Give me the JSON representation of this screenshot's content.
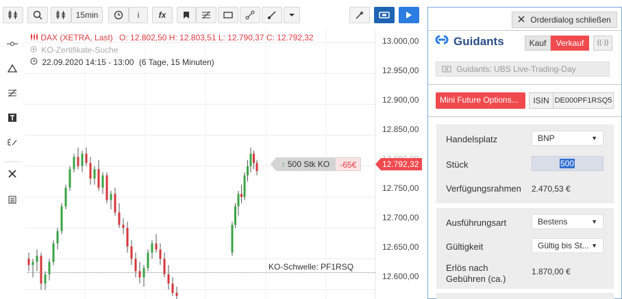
{
  "toolbar": {
    "interval_label": "15min",
    "info_label": "i",
    "fx_label": "fx"
  },
  "legend": {
    "instrument": "DAX (XETRA, Last)",
    "ohlc": "O: 12.802,50  H: 12.803,51  L: 12.790,37  C: 12.792,32",
    "ko_search": "KO-Zertifikate-Suche",
    "timestamp": "22.09.2020 14:15 - 13:00",
    "range": "(6 Tage, 15 Minuten)"
  },
  "axis": {
    "price_labels": [
      "13.000,00",
      "12.950,00",
      "12.900,00",
      "12.850,00",
      "12.800,00",
      "12.750,00",
      "12.700,00",
      "12.650,00",
      "12.600,00"
    ],
    "current_price": "12.792,32"
  },
  "position": {
    "label": "500 Stk KO",
    "pl": "-65€"
  },
  "ko": {
    "label": "KO-Schwelle: PF1RSQ"
  },
  "colors": {
    "up": "#3aa344",
    "down": "#d6363b",
    "accent_red": "#f04a4f",
    "accent_blue": "#2b7de1"
  },
  "panel": {
    "close_label": "Orderdialog schließen",
    "brand": "Guidants",
    "buy_label": "Kauf",
    "sell_label": "Verkauf",
    "account": "Guidants: UBS Live-Trading-Day",
    "product_button": "Mini Future Options...",
    "isin_label": "ISIN",
    "isin_value": "DE000PF1RSQ5",
    "rows": {
      "venue_label": "Handelsplatz",
      "venue_value": "BNP",
      "qty_label": "Stück",
      "qty_value": "500",
      "funds_label": "Verfügungsrahmen",
      "funds_value": "2.470,53 €",
      "exec_label": "Ausführungsart",
      "exec_value": "Bestens",
      "validity_label": "Gültigkeit",
      "validity_value": "Gültig bis St...",
      "proceeds_label_1": "Erlös nach",
      "proceeds_label_2": "Gebühren (ca.)",
      "proceeds_value": "1.870,00 €"
    }
  },
  "chart_data": {
    "type": "candlestick",
    "ylim": [
      12585,
      13020
    ],
    "ticks": [
      13000,
      12950,
      12900,
      12850,
      12800,
      12750,
      12700,
      12650,
      12600
    ],
    "current": 12792.32,
    "ko_level": 12603,
    "candles": [
      [
        12650,
        12660,
        12630,
        12640
      ],
      [
        12640,
        12650,
        12620,
        12645
      ],
      [
        12645,
        12665,
        12630,
        12655
      ],
      [
        12655,
        12660,
        12600,
        12610
      ],
      [
        12610,
        12630,
        12600,
        12625
      ],
      [
        12625,
        12650,
        12615,
        12645
      ],
      [
        12645,
        12680,
        12640,
        12675
      ],
      [
        12675,
        12700,
        12665,
        12695
      ],
      [
        12695,
        12740,
        12690,
        12735
      ],
      [
        12735,
        12770,
        12730,
        12765
      ],
      [
        12765,
        12800,
        12760,
        12795
      ],
      [
        12795,
        12820,
        12790,
        12815
      ],
      [
        12815,
        12830,
        12795,
        12800
      ],
      [
        12800,
        12825,
        12790,
        12820
      ],
      [
        12820,
        12830,
        12800,
        12805
      ],
      [
        12805,
        12815,
        12770,
        12780
      ],
      [
        12780,
        12800,
        12770,
        12795
      ],
      [
        12795,
        12810,
        12760,
        12765
      ],
      [
        12765,
        12790,
        12755,
        12785
      ],
      [
        12785,
        12790,
        12740,
        12745
      ],
      [
        12745,
        12760,
        12730,
        12755
      ],
      [
        12755,
        12765,
        12720,
        12725
      ],
      [
        12725,
        12740,
        12700,
        12705
      ],
      [
        12705,
        12715,
        12690,
        12700
      ],
      [
        12700,
        12710,
        12660,
        12670
      ],
      [
        12670,
        12680,
        12640,
        12650
      ],
      [
        12650,
        12660,
        12620,
        12630
      ],
      [
        12630,
        12645,
        12610,
        12620
      ],
      [
        12620,
        12640,
        12605,
        12635
      ],
      [
        12635,
        12665,
        12630,
        12660
      ],
      [
        12660,
        12680,
        12650,
        12675
      ],
      [
        12675,
        12690,
        12660,
        12665
      ],
      [
        12665,
        12675,
        12640,
        12650
      ],
      [
        12650,
        12660,
        12620,
        12625
      ],
      [
        12625,
        12640,
        12600,
        12610
      ],
      [
        12610,
        12620,
        12590,
        12595
      ],
      [
        12595,
        12605,
        12585,
        12590
      ],
      [
        12660,
        12710,
        12655,
        12705
      ],
      [
        12705,
        12740,
        12700,
        12735
      ],
      [
        12735,
        12760,
        12720,
        12755
      ],
      [
        12755,
        12770,
        12740,
        12750
      ],
      [
        12750,
        12790,
        12745,
        12785
      ],
      [
        12785,
        12810,
        12775,
        12800
      ],
      [
        12800,
        12830,
        12790,
        12820
      ],
      [
        12820,
        12825,
        12795,
        12805
      ],
      [
        12805,
        12810,
        12785,
        12792
      ]
    ]
  }
}
